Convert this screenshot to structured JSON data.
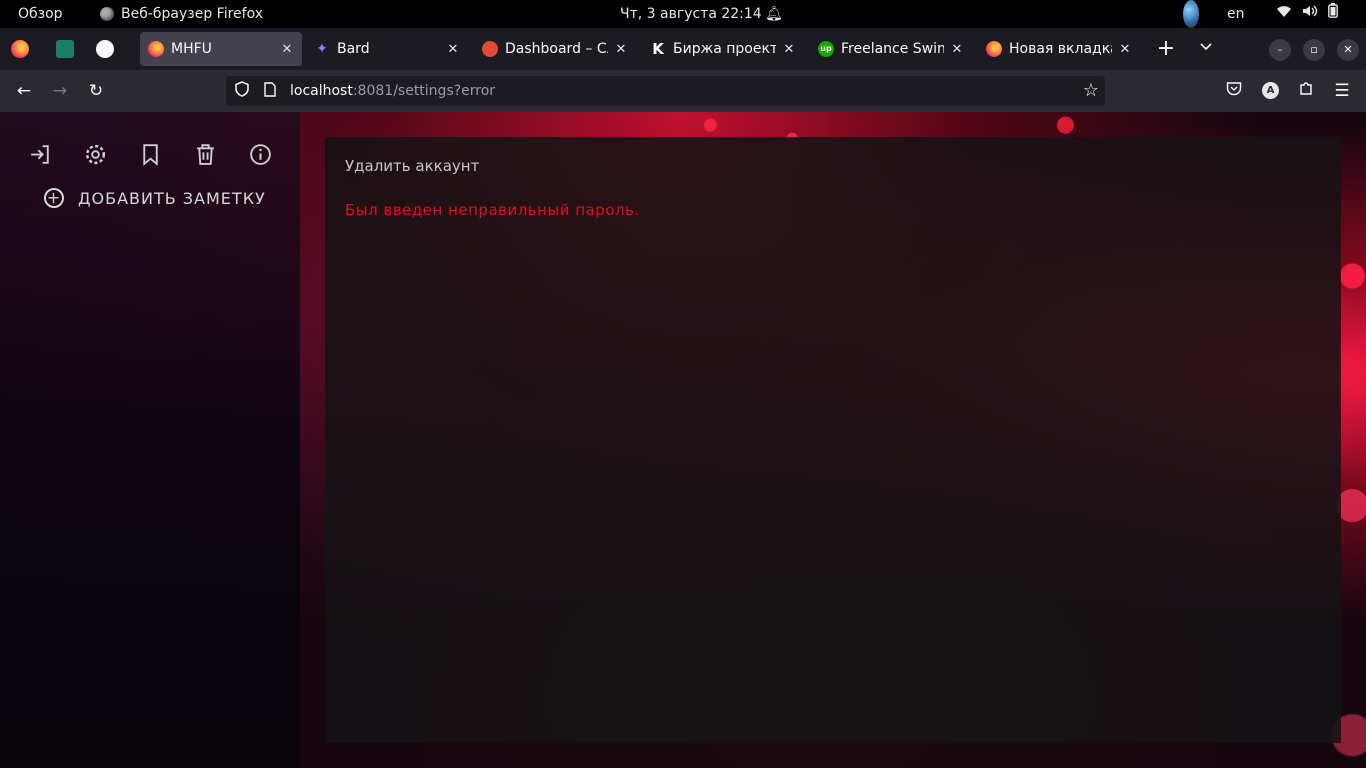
{
  "topbar": {
    "activities": "Обзор",
    "app_name": "Веб-браузер Firefox",
    "clock": "Чт, 3 августа  22:14",
    "lang": "en"
  },
  "tabs": [
    {
      "title": "MHFU",
      "active": true
    },
    {
      "title": "Bard",
      "active": false
    },
    {
      "title": "Dashboard – Сло",
      "active": false
    },
    {
      "title": "Биржа проектов",
      "active": false
    },
    {
      "title": "Freelance Swing",
      "active": false
    },
    {
      "title": "Новая вкладка",
      "active": false
    }
  ],
  "urlbar": {
    "host": "localhost",
    "rest": ":8081/settings?error"
  },
  "sidebar": {
    "icons": [
      "logout-icon",
      "settings-icon",
      "bookmark-icon",
      "trash-icon",
      "info-icon"
    ],
    "add_note_label": "ДОБАВИТЬ ЗАМЕТКУ"
  },
  "panel": {
    "title": "Удалить аккаунт",
    "error": "Был введен неправильный пароль."
  },
  "colors": {
    "error": "#e0111d",
    "tab_active": "#42414d",
    "toolbar": "#2b2a33",
    "tabstrip": "#1c1b22"
  }
}
